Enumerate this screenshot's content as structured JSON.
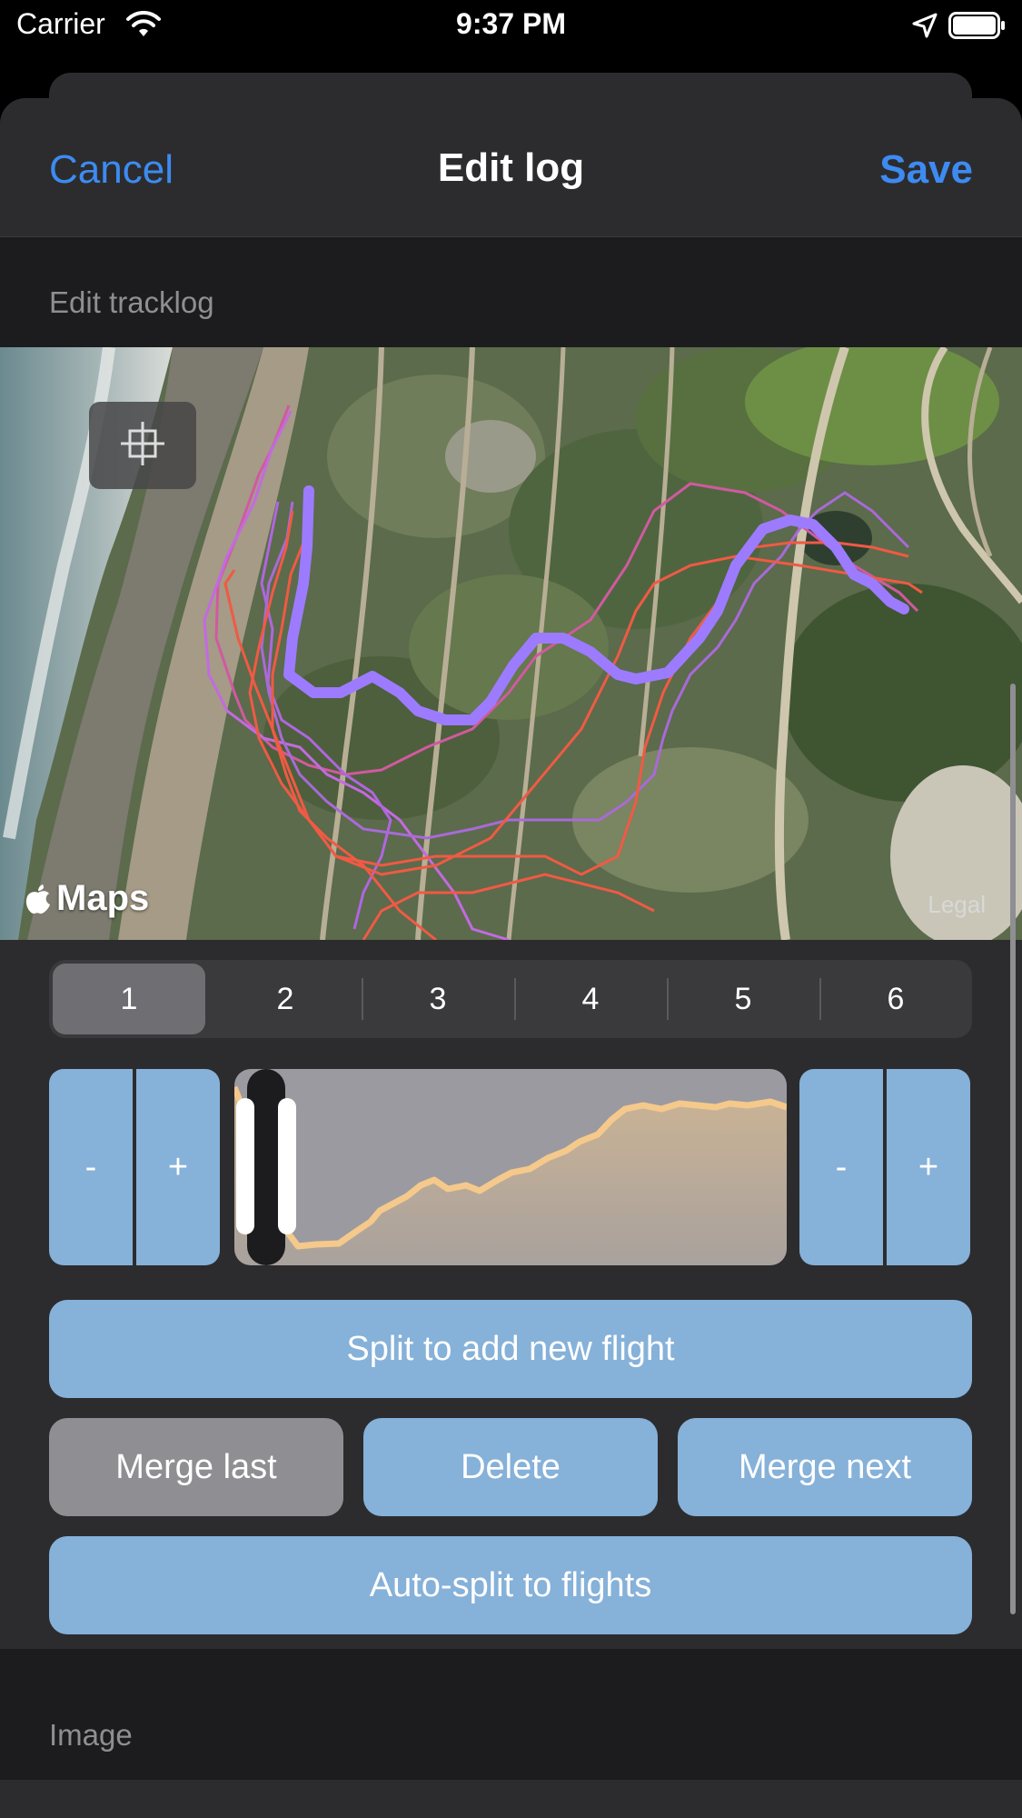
{
  "status_bar": {
    "carrier": "Carrier",
    "time": "9:37 PM",
    "icons": [
      "wifi-icon",
      "location-arrow-icon",
      "battery-icon"
    ]
  },
  "nav": {
    "cancel_label": "Cancel",
    "title": "Edit log",
    "save_label": "Save"
  },
  "tracklog_section": {
    "header": "Edit tracklog",
    "map": {
      "logo_text": "Maps",
      "legal_text": "Legal",
      "crop_button_icon": "crop-icon"
    },
    "segments": {
      "items": [
        "1",
        "2",
        "3",
        "4",
        "5",
        "6"
      ],
      "selected": "1"
    },
    "left_stepper": {
      "minus": "-",
      "plus": "+"
    },
    "right_stepper": {
      "minus": "-",
      "plus": "+"
    },
    "buttons": {
      "split": "Split to add new flight",
      "merge_last": "Merge last",
      "delete": "Delete",
      "merge_next": "Merge next",
      "auto_split": "Auto-split to flights"
    }
  },
  "image_section": {
    "header": "Image"
  },
  "colors": {
    "accent_blue": "#3d8bf2",
    "button_blue": "#86b1d9",
    "button_gray": "#8e8e93",
    "track_selected": "#9d7bff",
    "track_red": "#f05a44",
    "track_purple": "#b66de0",
    "altitude_line": "#f4c98b"
  }
}
